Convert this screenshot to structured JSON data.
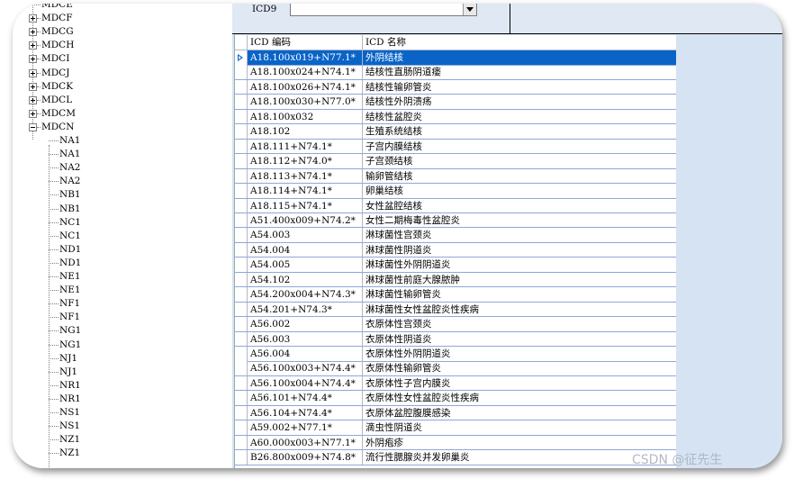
{
  "tree": {
    "top_partial": "MDCE",
    "collapsed": [
      "MDCF",
      "MDCG",
      "MDCH",
      "MDCI",
      "MDCJ",
      "MDCK",
      "MDCL",
      "MDCM"
    ],
    "expanded": "MDCN",
    "children": [
      "NA1",
      "NA1",
      "NA2",
      "NA2",
      "NB1",
      "NB1",
      "NC1",
      "NC1",
      "ND1",
      "ND1",
      "NE1",
      "NE1",
      "NF1",
      "NF1",
      "NG1",
      "NG1",
      "NJ1",
      "NJ1",
      "NR1",
      "NR1",
      "NS1",
      "NS1",
      "NZ1",
      "NZ1"
    ]
  },
  "filter": {
    "label": "ICD9",
    "value": ""
  },
  "grid": {
    "headers": [
      "ICD 编码",
      "ICD 名称"
    ],
    "selected_index": 0,
    "rows": [
      {
        "code": "A18.100x019+N77.1*",
        "name": "外阴结核"
      },
      {
        "code": "A18.100x024+N74.1*",
        "name": "结核性直肠阴道瘘"
      },
      {
        "code": "A18.100x026+N74.1*",
        "name": "结核性输卵管炎"
      },
      {
        "code": "A18.100x030+N77.0*",
        "name": "结核性外阴溃疡"
      },
      {
        "code": "A18.100x032",
        "name": "结核性盆腔炎"
      },
      {
        "code": "A18.102",
        "name": "生殖系统结核"
      },
      {
        "code": "A18.111+N74.1*",
        "name": "子宫内膜结核"
      },
      {
        "code": "A18.112+N74.0*",
        "name": "子宫颈结核"
      },
      {
        "code": "A18.113+N74.1*",
        "name": "输卵管结核"
      },
      {
        "code": "A18.114+N74.1*",
        "name": "卵巢结核"
      },
      {
        "code": "A18.115+N74.1*",
        "name": "女性盆腔结核"
      },
      {
        "code": "A51.400x009+N74.2*",
        "name": "女性二期梅毒性盆腔炎"
      },
      {
        "code": "A54.003",
        "name": "淋球菌性宫颈炎"
      },
      {
        "code": "A54.004",
        "name": "淋球菌性阴道炎"
      },
      {
        "code": "A54.005",
        "name": "淋球菌性外阴阴道炎"
      },
      {
        "code": "A54.102",
        "name": "淋球菌性前庭大腺脓肿"
      },
      {
        "code": "A54.200x004+N74.3*",
        "name": "淋球菌性输卵管炎"
      },
      {
        "code": "A54.201+N74.3*",
        "name": "淋球菌性女性盆腔炎性疾病"
      },
      {
        "code": "A56.002",
        "name": "衣原体性宫颈炎"
      },
      {
        "code": "A56.003",
        "name": "衣原体性阴道炎"
      },
      {
        "code": "A56.004",
        "name": "衣原体性外阴阴道炎"
      },
      {
        "code": "A56.100x003+N74.4*",
        "name": "衣原体性输卵管炎"
      },
      {
        "code": "A56.100x004+N74.4*",
        "name": "衣原体性子宫内膜炎"
      },
      {
        "code": "A56.101+N74.4*",
        "name": "衣原体性女性盆腔炎性疾病"
      },
      {
        "code": "A56.104+N74.4*",
        "name": "衣原体盆腔腹膜感染"
      },
      {
        "code": "A59.002+N77.1*",
        "name": "滴虫性阴道炎"
      },
      {
        "code": "A60.000x003+N77.1*",
        "name": "外阴疱疹"
      },
      {
        "code": "B26.800x009+N74.8*",
        "name": "流行性腮腺炎并发卵巢炎"
      }
    ]
  },
  "watermark": "CSDN @征先生",
  "colors": {
    "selection": "#0a64c8",
    "panel": "#d6e3f2",
    "grid_line": "#8fa7d6"
  }
}
